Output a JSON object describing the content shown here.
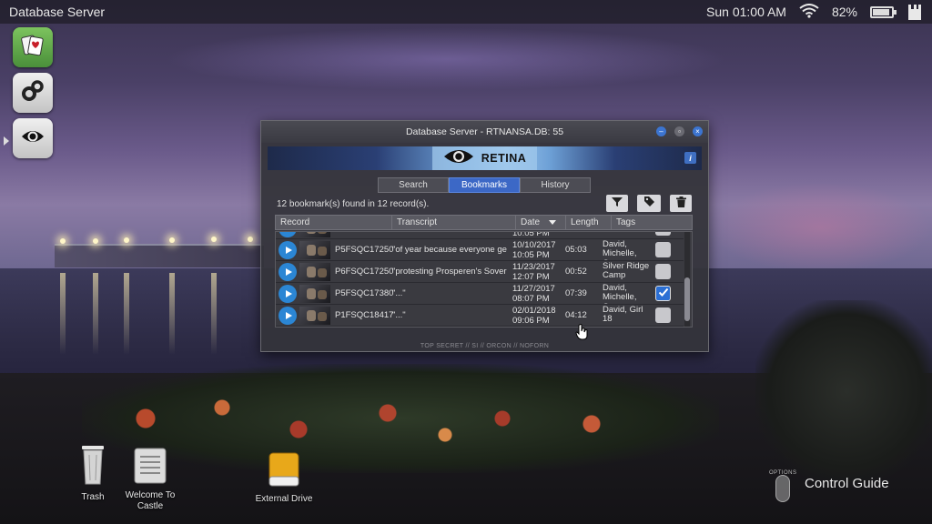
{
  "topbar": {
    "app_name": "Database Server",
    "clock": "Sun 01:00 AM",
    "battery_percent": "82%",
    "battery_level": 0.82
  },
  "dock": {
    "items": [
      {
        "name": "solitaire-app",
        "icon": "playing-cards-icon",
        "color": "#5aa34a"
      },
      {
        "name": "settings-app",
        "icon": "gears-icon",
        "color": "#d8d8d8"
      },
      {
        "name": "retina-app",
        "icon": "eye-icon",
        "color": "#d8d8d8",
        "active": true
      }
    ]
  },
  "window": {
    "title": "Database Server - RTNANSA.DB: 55",
    "banner_label": "RETINA",
    "tabs": [
      {
        "label": "Search",
        "active": false
      },
      {
        "label": "Bookmarks",
        "active": true
      },
      {
        "label": "History",
        "active": false
      }
    ],
    "summary": "12 bookmark(s) found in 12 record(s).",
    "columns": {
      "record": "Record",
      "transcript": "Transcript",
      "date": "Date",
      "length": "Length",
      "tags": "Tags"
    },
    "partial_row": {
      "date_time": "10:05 PM"
    },
    "rows": [
      {
        "id": "P5FSQC17250",
        "transcript": "\"of year because everyone gets a",
        "date": "10/10/2017",
        "time": "10:05 PM",
        "length": "05:03",
        "tags": "David, Michelle, Cam",
        "checked": false
      },
      {
        "id": "P6FSQC17250",
        "transcript": "\"protesting Prosperen's Sovereig",
        "date": "11/23/2017",
        "time": "12:07 PM",
        "length": "00:52",
        "tags": "Silver Ridge Camp",
        "checked": false
      },
      {
        "id": "P5FSQC17380",
        "transcript": "\"...\"",
        "date": "11/27/2017",
        "time": "08:07 PM",
        "length": "07:39",
        "tags": "David, Michelle, Cam",
        "checked": true
      },
      {
        "id": "P1FSQC18417",
        "transcript": "\"...\"",
        "date": "02/01/2018",
        "time": "09:06 PM",
        "length": "04:12",
        "tags": "David, Girl 18",
        "checked": false
      }
    ],
    "footer": "TOP SECRET // SI // ORCON // NOFORN"
  },
  "desktop": {
    "trash_label": "Trash",
    "welcome_label_1": "Welcome To",
    "welcome_label_2": "Castle",
    "drive_label": "External Drive"
  },
  "control_guide": {
    "options_label": "OPTIONS",
    "label": "Control Guide"
  },
  "colors": {
    "accent": "#3c68c6",
    "play": "#2b86d4"
  }
}
